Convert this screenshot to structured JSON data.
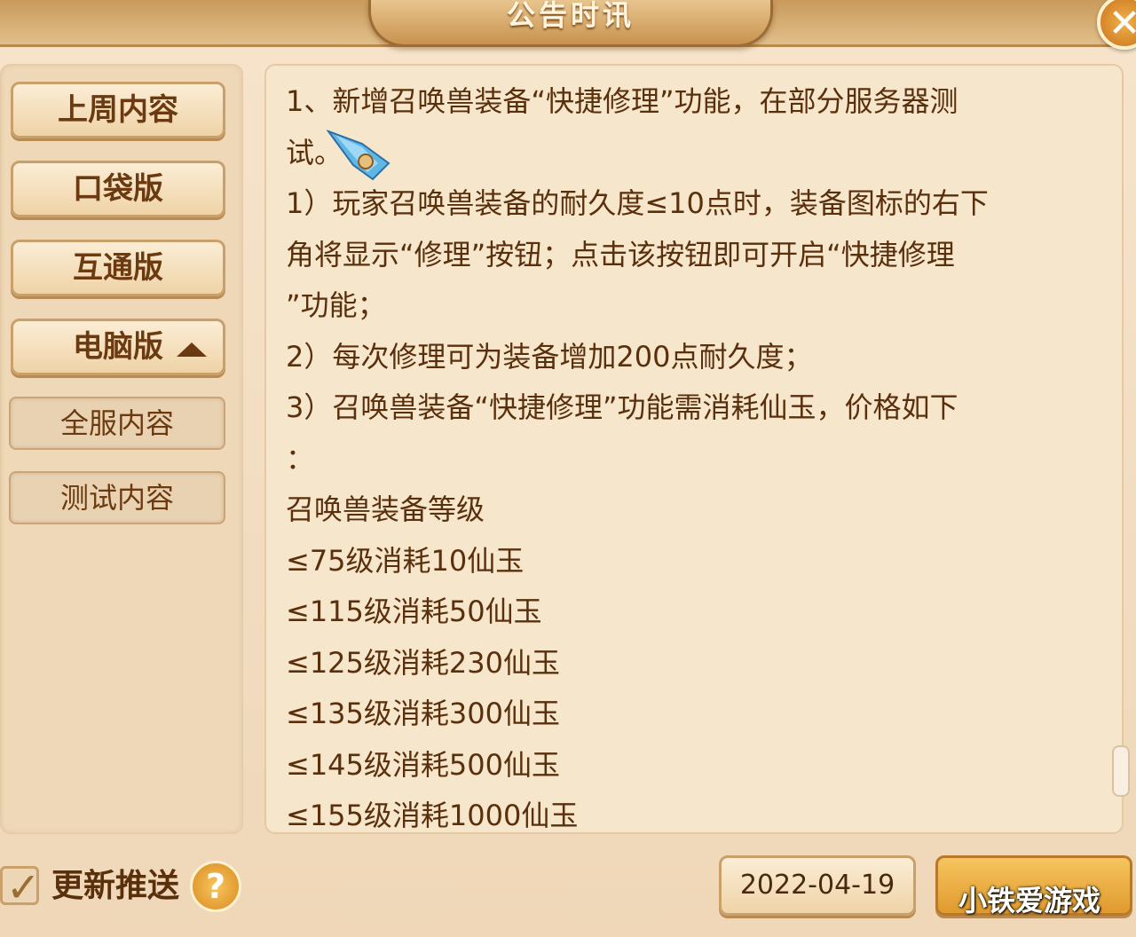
{
  "window": {
    "title": "公告时讯",
    "close_icon": "✕"
  },
  "sidebar": {
    "items": [
      {
        "label": "上周内容"
      },
      {
        "label": "口袋版"
      },
      {
        "label": "互通版"
      },
      {
        "label": "电脑版",
        "expanded": true
      }
    ],
    "subitems": [
      {
        "label": "全服内容"
      },
      {
        "label": "测试内容"
      }
    ]
  },
  "content": {
    "lines": [
      "1、新增召唤兽装备“快捷修理”功能，在部分服务器测",
      "试。",
      "1）玩家召唤兽装备的耐久度≤10点时，装备图标的右下",
      "角将显示“修理”按钮；点击该按钮即可开启“快捷修理",
      "”功能；",
      "2）每次修理可为装备增加200点耐久度；",
      "3）召唤兽装备“快捷修理”功能需消耗仙玉，价格如下",
      "：",
      "召唤兽装备等级",
      "≤75级消耗10仙玉",
      "≤115级消耗50仙玉",
      "≤125级消耗230仙玉",
      "≤135级消耗300仙玉",
      "≤145级消耗500仙玉",
      "≤155级消耗1000仙玉"
    ]
  },
  "footer": {
    "push_label": "更新推送",
    "push_checked": true,
    "help_icon": "?",
    "dates": [
      "2022-04-19",
      ""
    ]
  },
  "watermark": "小铁爱游戏",
  "colors": {
    "text": "#5a300c",
    "accent": "#e09a2e",
    "panel": "#f6e6cc"
  }
}
